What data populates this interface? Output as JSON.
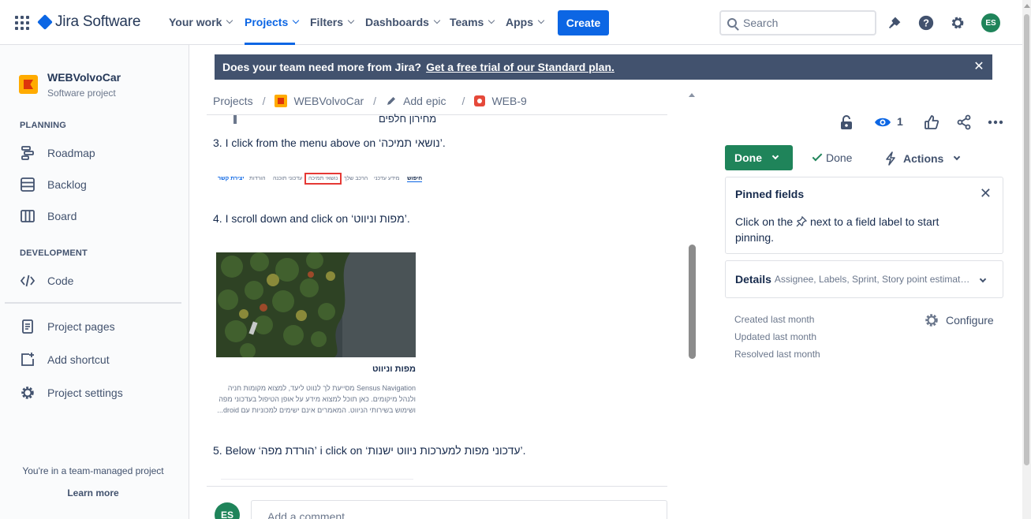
{
  "topnav": {
    "product_name": "Jira Software",
    "items": [
      {
        "label": "Your work"
      },
      {
        "label": "Projects"
      },
      {
        "label": "Filters"
      },
      {
        "label": "Dashboards"
      },
      {
        "label": "Teams"
      },
      {
        "label": "Apps"
      }
    ],
    "active_item": "Projects",
    "create_label": "Create",
    "search_placeholder": "Search",
    "avatar_initials": "ES"
  },
  "sidebar": {
    "project_name": "WEBVolvoCar",
    "project_type": "Software project",
    "planning_heading": "PLANNING",
    "planning_items": [
      {
        "label": "Roadmap",
        "icon": "roadmap-icon"
      },
      {
        "label": "Backlog",
        "icon": "backlog-icon"
      },
      {
        "label": "Board",
        "icon": "board-icon"
      }
    ],
    "development_heading": "DEVELOPMENT",
    "development_items": [
      {
        "label": "Code",
        "icon": "code-icon"
      }
    ],
    "other_items": [
      {
        "label": "Project pages",
        "icon": "page-icon"
      },
      {
        "label": "Add shortcut",
        "icon": "add-shortcut-icon"
      },
      {
        "label": "Project settings",
        "icon": "gear-icon"
      }
    ],
    "footer_text": "You're in a team-managed project",
    "learn_more": "Learn more"
  },
  "banner": {
    "text": "Does your team need more from Jira?",
    "link": "Get a free trial of our Standard plan."
  },
  "breadcrumb": {
    "projects": "Projects",
    "project": "WEBVolvoCar",
    "add_epic": "Add epic",
    "issue_key": "WEB-9"
  },
  "description": {
    "partial_line": "מחירון חלפים",
    "step3": "3.  I click from the menu above on ‘נושאי תמיכה’.",
    "menu_strip": [
      "חיפוש",
      "מידע עדכני",
      "הרכב שלך",
      "נושאי תמיכה",
      "עדכוני תוכנה",
      "הורדות",
      "יצירת קשר"
    ],
    "step4": "4. I scroll down and click on ‘מפות וניווט’.",
    "image_caption_title": "מפות וניווט",
    "image_caption_body": "Sensus Navigation מסייעת לך לנווט ליעד, למצוא מקומות חניה ולנהל מיקומים. כאן תוכל למצוא מידע על אופן הטיפול בעדכוני מפה ושימוש בשירותי הניווט. המאמרים אינם ישימים למכוניות עם droid...",
    "step5": "5. Below ‘הורדת מפה’ i click on ‘עדכוני מפות למערכות ניווט ישנות’."
  },
  "comment": {
    "avatar_initials": "ES",
    "placeholder": "Add a comment..."
  },
  "issue_panel": {
    "watch_count": "1",
    "status_button": "Done",
    "resolution": "Done",
    "actions_label": "Actions",
    "pinned_title": "Pinned fields",
    "pinned_text_before": "Click on the",
    "pinned_text_after": "next to a field label to start pinning.",
    "details_label": "Details",
    "details_fields": "Assignee, Labels, Sprint, Story point estimate,...",
    "created": "Created last month",
    "updated": "Updated last month",
    "resolved": "Resolved last month",
    "configure": "Configure"
  },
  "colors": {
    "brand_blue": "#0c66e4",
    "done_green": "#1f845a",
    "banner_bg": "#42526e"
  }
}
